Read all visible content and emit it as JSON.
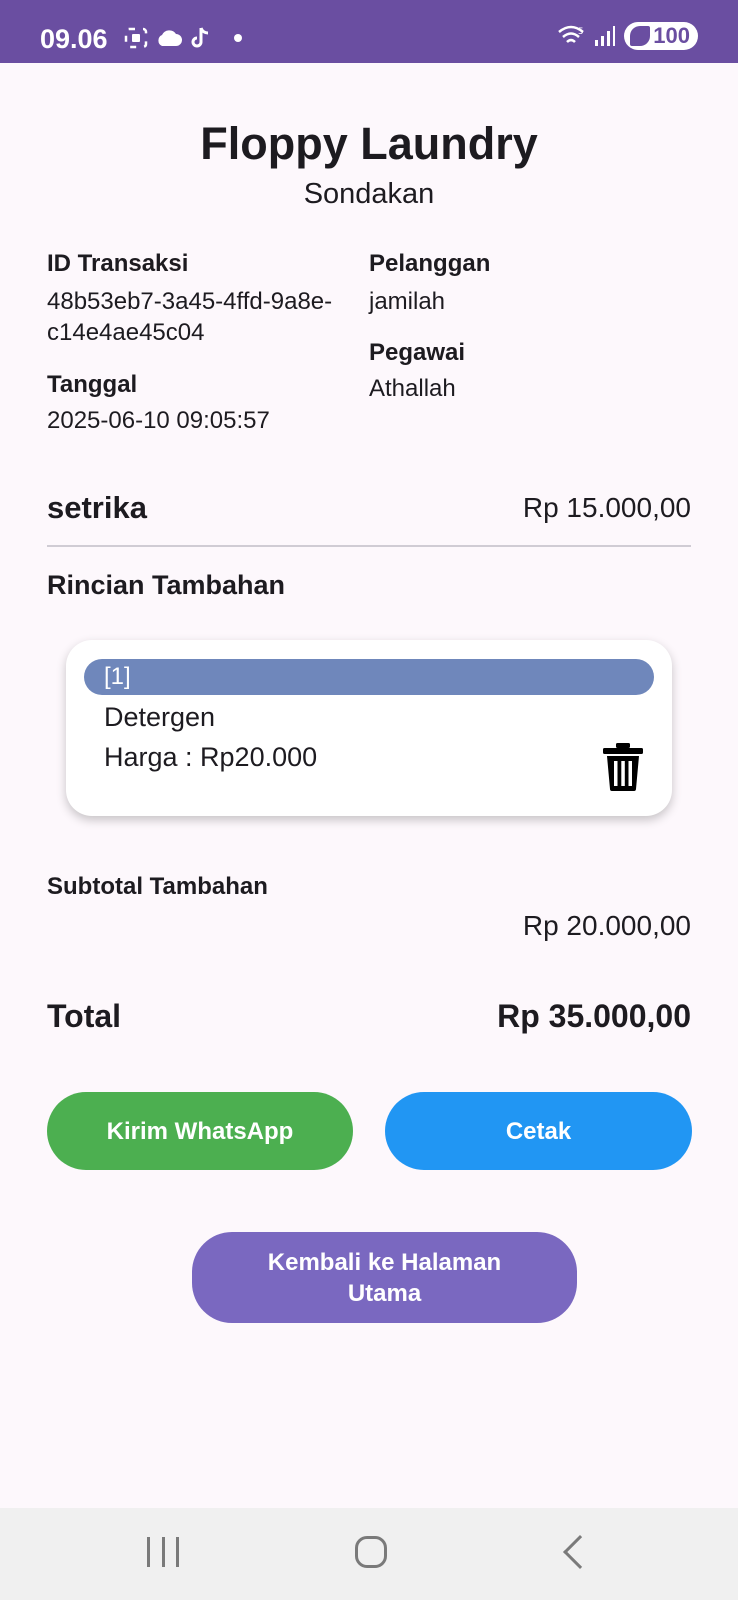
{
  "status_bar": {
    "time": "09.06",
    "network_label": "5",
    "battery": "100"
  },
  "header": {
    "title": "Floppy Laundry",
    "subtitle": "Sondakan"
  },
  "info": {
    "id_label": "ID Transaksi",
    "id_line1": "48b53eb7-3a45-4ffd-9a8e-",
    "id_line2": "c14e4ae45c04",
    "date_label": "Tanggal",
    "date_value": "2025-06-10 09:05:57",
    "customer_label": "Pelanggan",
    "customer_value": "jamilah",
    "employee_label": "Pegawai",
    "employee_value": "Athallah"
  },
  "service": {
    "name": "setrika",
    "price": "Rp 15.000,00"
  },
  "extras": {
    "heading": "Rincian Tambahan",
    "items": [
      {
        "index": "[1]",
        "name": "Detergen",
        "price": "Harga : Rp20.000"
      }
    ]
  },
  "subtotal": {
    "label": "Subtotal Tambahan",
    "value": "Rp 20.000,00"
  },
  "total": {
    "label": "Total",
    "value": "Rp 35.000,00"
  },
  "actions": {
    "whatsapp": "Kirim WhatsApp",
    "print": "Cetak",
    "home": "Kembali ke Halaman Utama"
  },
  "colors": {
    "status_bar": "#6a4ea1",
    "card_header": "#6f87bb",
    "whatsapp_button": "#4caf50",
    "print_button": "#2196f3",
    "home_button": "#7a68c0"
  }
}
